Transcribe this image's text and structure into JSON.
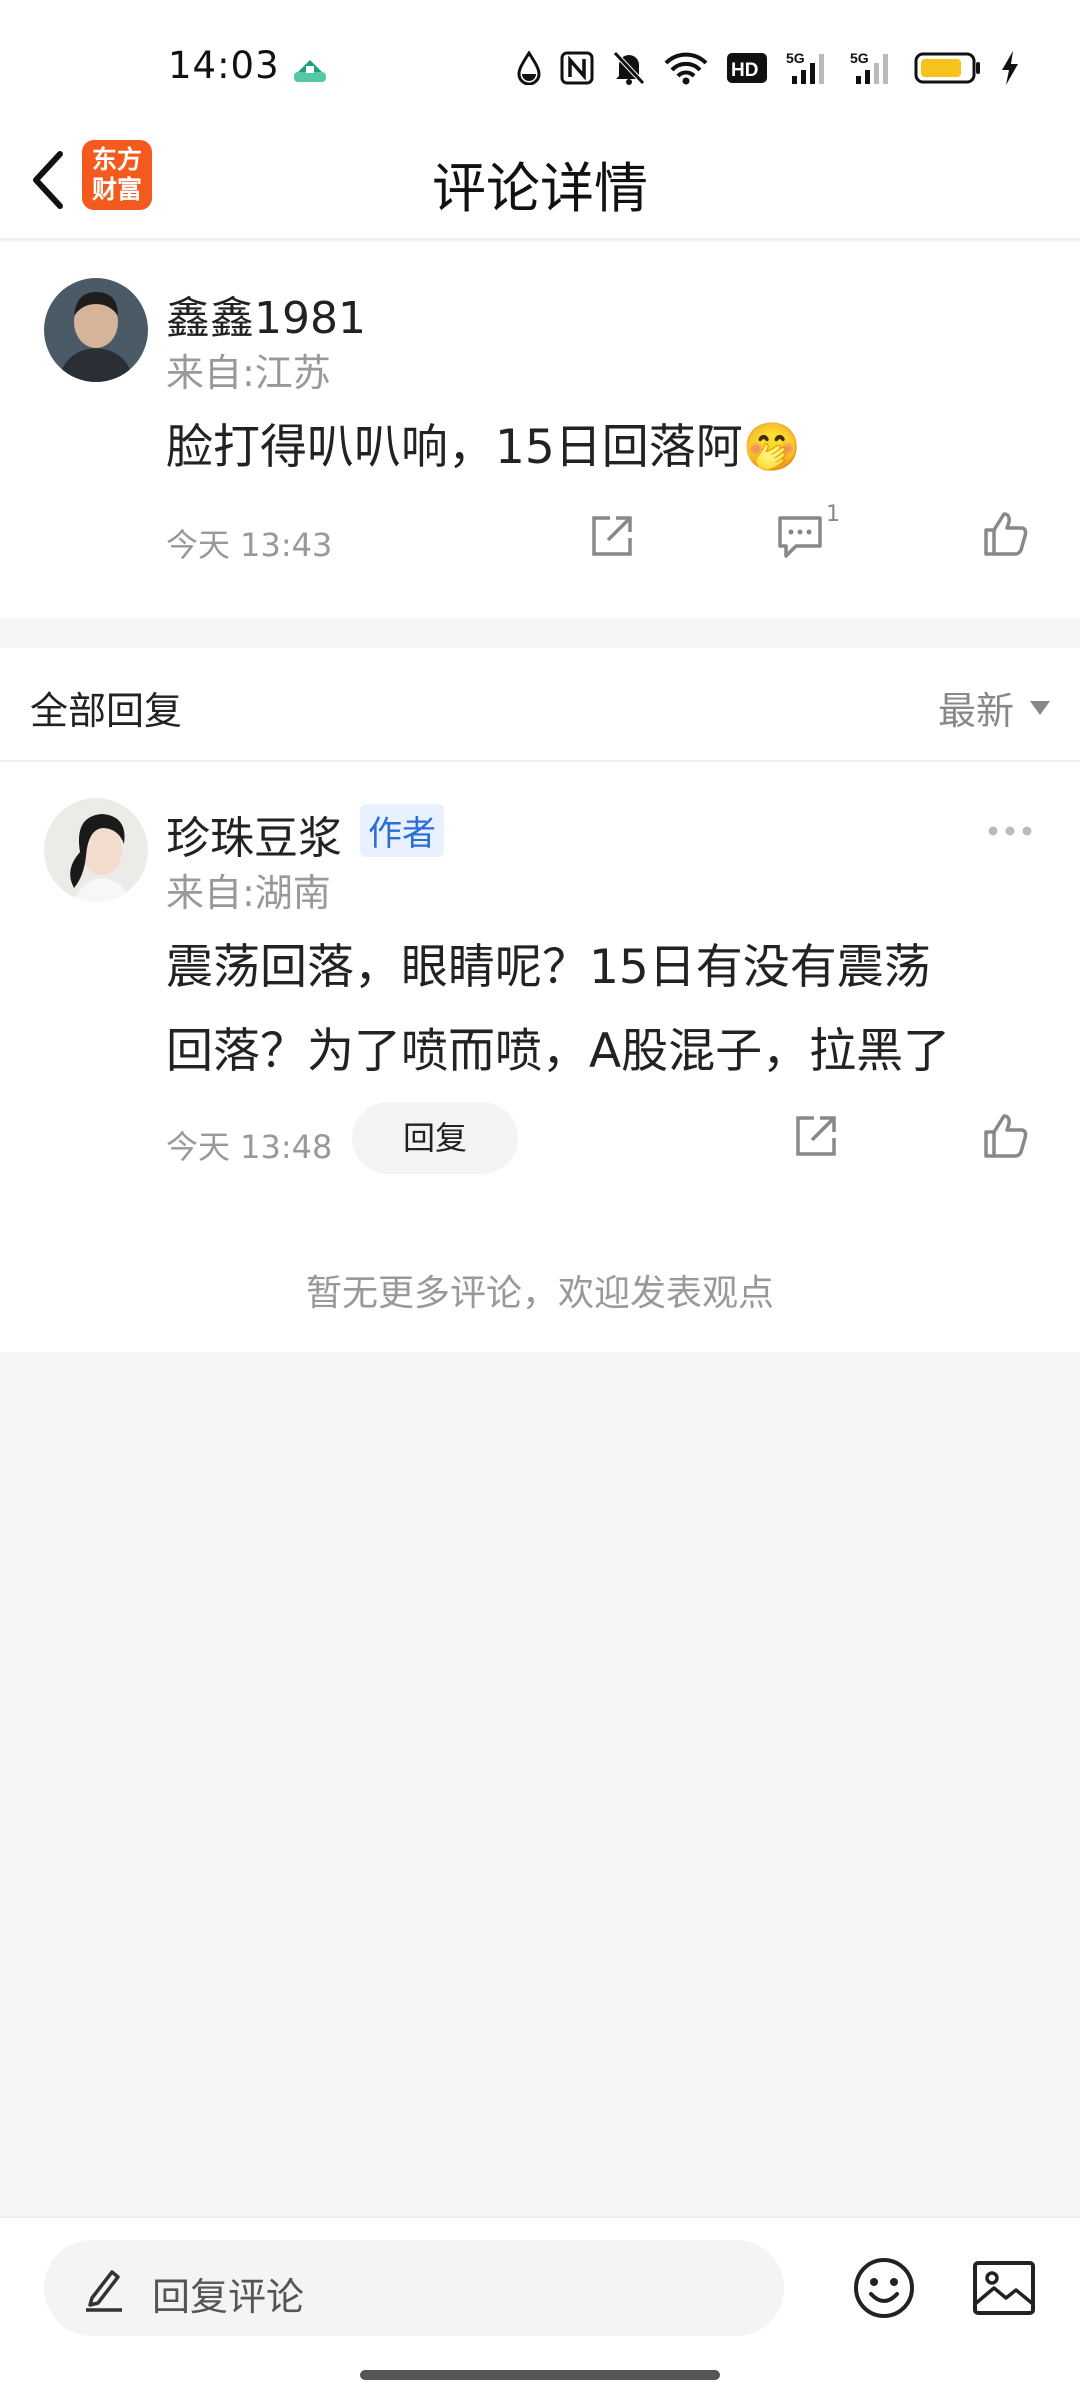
{
  "status_bar": {
    "time": "14:03",
    "icons": [
      "app-notification-icon",
      "dnd-drop-icon",
      "nfc-icon",
      "mute-bell-icon",
      "wifi-icon",
      "hd-icon",
      "signal-5g-icon",
      "signal-5g-icon",
      "battery-icon",
      "charging-icon"
    ]
  },
  "header": {
    "title": "评论详情",
    "logo_line1": "东方",
    "logo_line2": "财富",
    "brand_color": "#f45a1e"
  },
  "main_comment": {
    "username": "鑫鑫1981",
    "location": "来自:江苏",
    "text": "脸打得叭叭响，15日回落阿🤭",
    "time": "今天 13:43",
    "reply_count": "1"
  },
  "replies": {
    "header_label": "全部回复",
    "sort_label": "最新",
    "items": [
      {
        "username": "珍珠豆浆",
        "badge": "作者",
        "location": "来自:湖南",
        "text_line1": "震荡回落，眼睛呢？15日有没有震荡",
        "text_line2": "回落？为了喷而喷，A股混子，拉黑了",
        "time": "今天 13:48",
        "reply_button": "回复"
      }
    ],
    "no_more_text": "暂无更多评论，欢迎发表观点"
  },
  "bottom_bar": {
    "input_placeholder": "回复评论"
  }
}
